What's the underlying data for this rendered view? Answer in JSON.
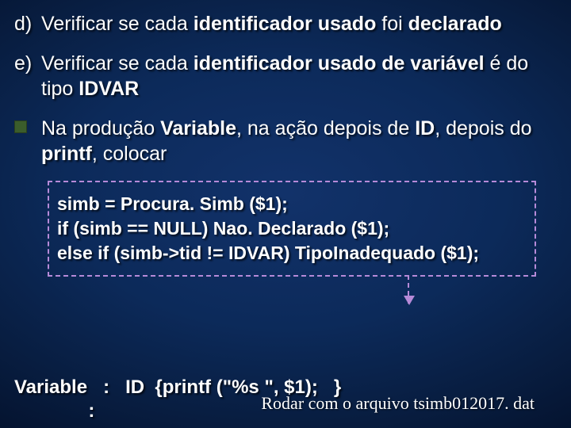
{
  "items": [
    {
      "marker": "d)",
      "html": "Verificar se cada <span class=\"b\">identificador usado</span> foi <span class=\"b\">declarado</span>"
    },
    {
      "marker": "e)",
      "html": "Verificar se cada <span class=\"b\">identificador usado de variável</span> é do tipo <span class=\"b\">IDVAR</span>"
    },
    {
      "marker_square": true,
      "html": "Na produção <span class=\"b\">Variable</span>, na ação depois de <span class=\"b\">ID</span>, depois do <span class=\"b\">printf</span>, colocar"
    }
  ],
  "code_lines": [
    "simb = Procura. Simb ($1);",
    "if (simb == NULL)   Nao. Declarado ($1);",
    "else if (simb->tid != IDVAR)   TipoInadequado ($1);"
  ],
  "grammar": {
    "lhs": "Variable",
    "line1_rest": "   :   ID  {printf (\"%s \", $1);   }",
    "line2": "              :"
  },
  "note": "Rodar com o arquivo tsimb012017. dat"
}
